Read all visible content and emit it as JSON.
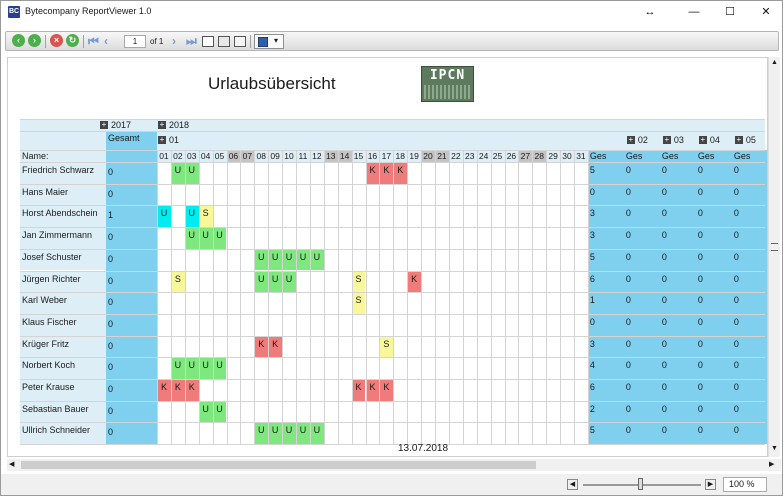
{
  "window": {
    "title": "Bytecompany ReportViewer 1.0",
    "app_icon_text": "BC",
    "controls": {
      "resize": "↔",
      "minimize": "—",
      "maximize": "☐",
      "close": "✕"
    }
  },
  "toolbar": {
    "page_current": "1",
    "page_of": "of 1",
    "buttons": [
      "back-icon",
      "forward-icon",
      "stop-icon",
      "refresh-icon",
      "first-page-icon",
      "previous-page-icon",
      "next-page-icon",
      "last-page-icon",
      "layout-icon",
      "page-setup-icon",
      "print-icon",
      "save-icon"
    ]
  },
  "report": {
    "title": "Urlaubsübersicht",
    "logo_text": "IPCN",
    "footer_date": "13.07.2018",
    "group_2017": "2017",
    "group_2018": "2018",
    "group_01": "01",
    "name_header": "Name:",
    "gesamt_header": "Gesamt",
    "collapsed_groups": [
      "02",
      "03",
      "04",
      "05"
    ],
    "ges_label": "Ges",
    "days": [
      "01",
      "02",
      "03",
      "04",
      "05",
      "06",
      "07",
      "08",
      "09",
      "10",
      "11",
      "12",
      "13",
      "14",
      "15",
      "16",
      "17",
      "18",
      "19",
      "20",
      "21",
      "22",
      "23",
      "24",
      "25",
      "26",
      "27",
      "28",
      "29",
      "30",
      "31"
    ],
    "weekend_days": [
      "06",
      "07",
      "13",
      "14",
      "20",
      "21",
      "27",
      "28"
    ],
    "rows": [
      {
        "name": "Friedrich Schwarz",
        "gesamt": "0",
        "ges01": "5",
        "other": [
          "0",
          "0",
          "0",
          "0"
        ],
        "marks": {
          "02": "U",
          "03": "U",
          "16": "K",
          "17": "K",
          "18": "K"
        }
      },
      {
        "name": "Hans Maier",
        "gesamt": "0",
        "ges01": "0",
        "other": [
          "0",
          "0",
          "0",
          "0"
        ],
        "marks": {}
      },
      {
        "name": "Horst Abendschein",
        "gesamt": "1",
        "ges01": "3",
        "other": [
          "0",
          "0",
          "0",
          "0"
        ],
        "marks": {
          "01": "U",
          "03": "U",
          "04": "S"
        }
      },
      {
        "name": "Jan Zimmermann",
        "gesamt": "0",
        "ges01": "3",
        "other": [
          "0",
          "0",
          "0",
          "0"
        ],
        "marks": {
          "03": "U",
          "04": "U",
          "05": "U"
        }
      },
      {
        "name": "Josef Schuster",
        "gesamt": "0",
        "ges01": "5",
        "other": [
          "0",
          "0",
          "0",
          "0"
        ],
        "marks": {
          "08": "U",
          "09": "U",
          "10": "U",
          "11": "U",
          "12": "U"
        }
      },
      {
        "name": "Jürgen Richter",
        "gesamt": "0",
        "ges01": "6",
        "other": [
          "0",
          "0",
          "0",
          "0"
        ],
        "marks": {
          "02": "S",
          "08": "U",
          "09": "U",
          "10": "U",
          "15": "S",
          "19": "K"
        }
      },
      {
        "name": "Karl Weber",
        "gesamt": "0",
        "ges01": "1",
        "other": [
          "0",
          "0",
          "0",
          "0"
        ],
        "marks": {
          "15": "S"
        }
      },
      {
        "name": "Klaus Fischer",
        "gesamt": "0",
        "ges01": "0",
        "other": [
          "0",
          "0",
          "0",
          "0"
        ],
        "marks": {}
      },
      {
        "name": "Krüger Fritz",
        "gesamt": "0",
        "ges01": "3",
        "other": [
          "0",
          "0",
          "0",
          "0"
        ],
        "marks": {
          "08": "K",
          "09": "K",
          "17": "S"
        }
      },
      {
        "name": "Norbert Koch",
        "gesamt": "0",
        "ges01": "4",
        "other": [
          "0",
          "0",
          "0",
          "0"
        ],
        "marks": {
          "02": "U",
          "03": "U",
          "04": "U",
          "05": "U"
        }
      },
      {
        "name": "Peter Krause",
        "gesamt": "0",
        "ges01": "6",
        "other": [
          "0",
          "0",
          "0",
          "0"
        ],
        "marks": {
          "01": "K",
          "02": "K",
          "03": "K",
          "15": "K",
          "16": "K",
          "17": "K"
        }
      },
      {
        "name": "Sebastian Bauer",
        "gesamt": "0",
        "ges01": "2",
        "other": [
          "0",
          "0",
          "0",
          "0"
        ],
        "marks": {
          "04": "U",
          "05": "U"
        }
      },
      {
        "name": "Ullrich Schneider",
        "gesamt": "0",
        "ges01": "5",
        "other": [
          "0",
          "0",
          "0",
          "0"
        ],
        "marks": {
          "08": "U",
          "09": "U",
          "10": "U",
          "11": "U",
          "12": "U"
        }
      }
    ]
  },
  "colors": {
    "header_bg": "#ddeef7",
    "total_bg": "#7fcfef",
    "weekend_bg": "#c4c4c4",
    "mark_U": "#7ee87e",
    "mark_K": "#f07b7b",
    "mark_S": "#f8f89a",
    "mark_U_first": "#00ecf0"
  },
  "statusbar": {
    "zoom": "100 %"
  }
}
